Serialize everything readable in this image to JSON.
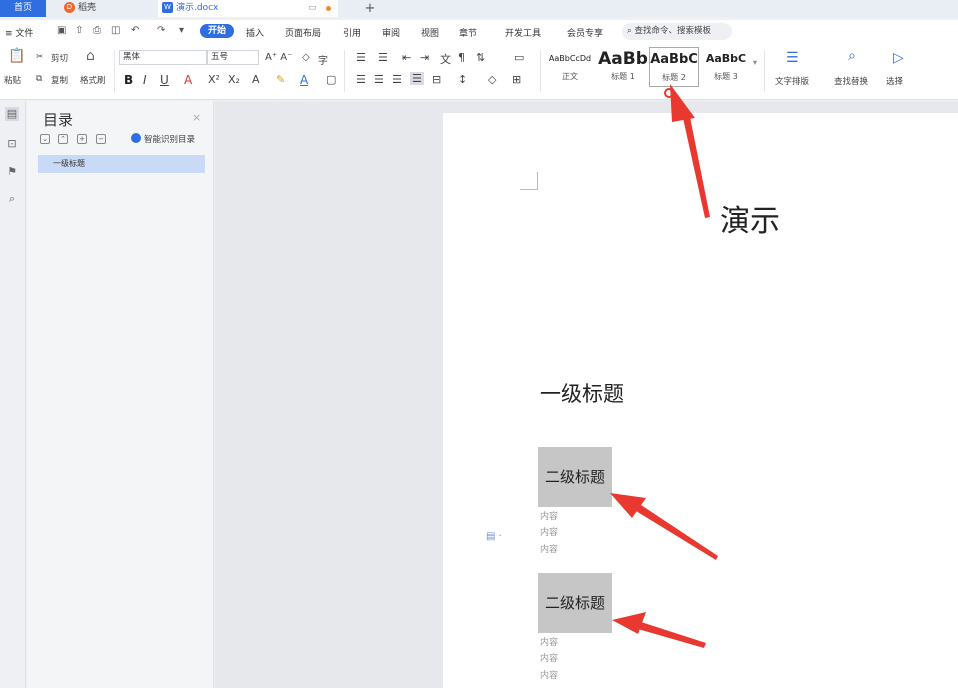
{
  "titlebar": {
    "tabs": [
      {
        "label": "首页"
      },
      {
        "label": "稻壳"
      },
      {
        "label": "演示.docx"
      }
    ],
    "new_tab": "+"
  },
  "menubar": {
    "file": "≡ 文件",
    "items": [
      "开始",
      "插入",
      "页面布局",
      "引用",
      "审阅",
      "视图",
      "章节",
      "开发工具",
      "会员专享"
    ],
    "search_placeholder": "查找命令、搜索模板"
  },
  "ribbon": {
    "paste": "粘贴",
    "cut": "剪切",
    "copy": "复制",
    "format_painter": "格式刷",
    "font_name": "黑体",
    "font_size": "五号",
    "styles": [
      {
        "preview": "AaBbCcDd",
        "name": "正文"
      },
      {
        "preview": "AaBb",
        "name": "标题 1"
      },
      {
        "preview": "AaBbC",
        "name": "标题 2"
      },
      {
        "preview": "AaBbC",
        "name": "标题 3"
      }
    ],
    "text_layout": "文字排版",
    "find_replace": "查找替换",
    "select": "选择"
  },
  "toc": {
    "title": "目录",
    "close": "×",
    "smart_label": "智能识别目录",
    "items": [
      "一级标题"
    ]
  },
  "document": {
    "annotation": "演示",
    "heading1": "一级标题",
    "sections": [
      {
        "heading": "二级标题",
        "lines": [
          "内容",
          "内容",
          "内容"
        ]
      },
      {
        "heading": "二级标题",
        "lines": [
          "内容",
          "内容",
          "内容"
        ]
      }
    ]
  },
  "colors": {
    "accent": "#2f6ee0",
    "arrow": "#e8382f",
    "heading_bg": "#c6c6c6"
  }
}
